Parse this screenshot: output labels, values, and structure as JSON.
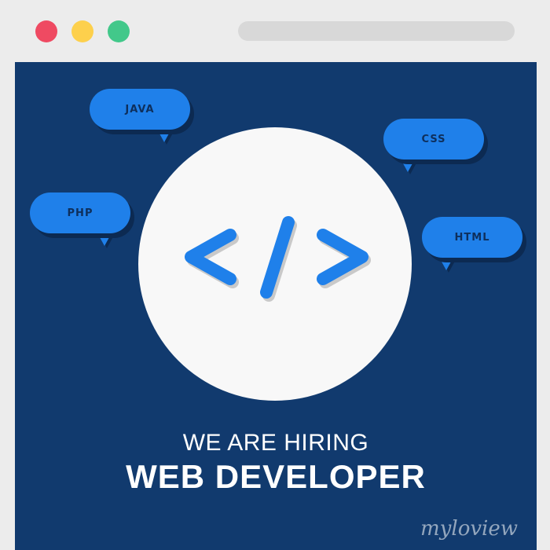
{
  "window": {
    "controls": [
      "close-dot",
      "minimize-dot",
      "maximize-dot"
    ],
    "colors": {
      "close": "#ef4a62",
      "minimize": "#fdd04c",
      "maximize": "#42c88a",
      "panel": "#113a6e",
      "bubble": "#1f80ea"
    }
  },
  "bubbles": {
    "java": "JAVA",
    "css": "CSS",
    "php": "PHP",
    "html": "HTML"
  },
  "hero": {
    "icon": "code-icon",
    "headline": "WE ARE HIRING",
    "role": "WEB DEVELOPER"
  },
  "watermark": "myloview"
}
